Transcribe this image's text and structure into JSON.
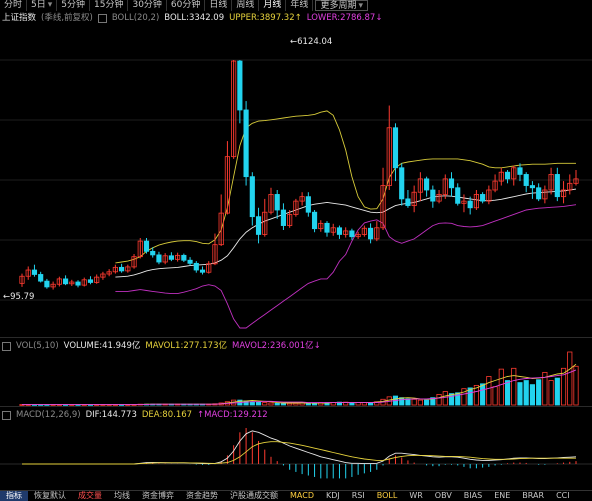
{
  "top_tabs": [
    {
      "label": "分时",
      "active": false,
      "caret": false
    },
    {
      "label": "5日",
      "active": false,
      "caret": true
    },
    {
      "label": "5分钟",
      "active": false,
      "caret": false
    },
    {
      "label": "15分钟",
      "active": false,
      "caret": false
    },
    {
      "label": "30分钟",
      "active": false,
      "caret": false
    },
    {
      "label": "60分钟",
      "active": false,
      "caret": false
    },
    {
      "label": "日线",
      "active": false,
      "caret": false
    },
    {
      "label": "周线",
      "active": false,
      "caret": false
    },
    {
      "label": "月线",
      "active": true,
      "caret": false
    },
    {
      "label": "年线",
      "active": false,
      "caret": false
    },
    {
      "label": "更多周期",
      "active": false,
      "caret": true
    }
  ],
  "main_legend": {
    "index_name": "上证指数",
    "adjust": "(季线,前复权)",
    "indicator": "BOLL(20,2)",
    "boll": "BOLL:3342.09",
    "upper": "UPPER:3897.32",
    "lower": "LOWER:2786.87",
    "up_arrow": "↑",
    "down_arrow": "↓"
  },
  "vol_legend": {
    "indicator": "VOL(5,10)",
    "volume": "VOLUME:41.949亿",
    "mavol1": "MAVOL1:277.173亿",
    "mavol2": "MAVOL2:236.001亿",
    "down_arrow": "↓"
  },
  "macd_legend": {
    "indicator": "MACD(12,26,9)",
    "dif": "DIF:144.773",
    "dea": "DEA:80.167",
    "macd": "MACD:129.212",
    "up_arrow": "↑"
  },
  "annotations": {
    "high": "6124.04",
    "low": "95.79"
  },
  "bottom_tabs": [
    {
      "label": "指标",
      "style": "active"
    },
    {
      "label": "恢复默认",
      "style": ""
    },
    {
      "label": "成交量",
      "style": "hl"
    },
    {
      "label": "均线",
      "style": ""
    },
    {
      "label": "资金博弈",
      "style": ""
    },
    {
      "label": "资金趋势",
      "style": ""
    },
    {
      "label": "沪股通成交额",
      "style": ""
    },
    {
      "label": "MACD",
      "style": "yl"
    },
    {
      "label": "KDJ",
      "style": ""
    },
    {
      "label": "RSI",
      "style": ""
    },
    {
      "label": "BOLL",
      "style": "yl"
    },
    {
      "label": "WR",
      "style": ""
    },
    {
      "label": "OBV",
      "style": ""
    },
    {
      "label": "BIAS",
      "style": ""
    },
    {
      "label": "ENE",
      "style": ""
    },
    {
      "label": "BRAR",
      "style": ""
    },
    {
      "label": "CCI",
      "style": ""
    }
  ],
  "colors": {
    "up": "#ff3b30",
    "down": "#22d3ee",
    "boll_mid": "#e8e8e8",
    "boll_upper": "#d8cc3a",
    "boll_lower": "#c030c0",
    "grid": "#1e1e1e"
  },
  "chart_data": {
    "type": "candlestick",
    "title": "上证指数",
    "period": "季线",
    "indicator": "BOLL(20,2)",
    "y_range": [
      95.79,
      6124.04
    ],
    "max_label": "6124.04",
    "min_label": "95.79",
    "candles": [
      [
        1100,
        1260,
        1020,
        1320
      ],
      [
        1260,
        1400,
        1180,
        1480
      ],
      [
        1400,
        1300,
        1250,
        1520
      ],
      [
        1300,
        1150,
        1120,
        1360
      ],
      [
        1150,
        1020,
        980,
        1200
      ],
      [
        1020,
        1080,
        960,
        1140
      ],
      [
        1080,
        1200,
        1030,
        1250
      ],
      [
        1200,
        1090,
        1060,
        1280
      ],
      [
        1090,
        1130,
        1040,
        1180
      ],
      [
        1130,
        1060,
        1010,
        1170
      ],
      [
        1060,
        1180,
        1030,
        1230
      ],
      [
        1180,
        1120,
        1080,
        1260
      ],
      [
        1120,
        1240,
        1090,
        1300
      ],
      [
        1240,
        1310,
        1180,
        1360
      ],
      [
        1310,
        1360,
        1260,
        1420
      ],
      [
        1360,
        1460,
        1320,
        1520
      ],
      [
        1460,
        1380,
        1340,
        1540
      ],
      [
        1380,
        1470,
        1340,
        1520
      ],
      [
        1470,
        1700,
        1430,
        1760
      ],
      [
        1700,
        2050,
        1660,
        2120
      ],
      [
        2050,
        1820,
        1770,
        2120
      ],
      [
        1820,
        1740,
        1680,
        1910
      ],
      [
        1740,
        1580,
        1530,
        1810
      ],
      [
        1580,
        1720,
        1530,
        1780
      ],
      [
        1720,
        1640,
        1600,
        1800
      ],
      [
        1640,
        1730,
        1590,
        1790
      ],
      [
        1730,
        1620,
        1580,
        1770
      ],
      [
        1620,
        1550,
        1500,
        1690
      ],
      [
        1550,
        1400,
        1340,
        1600
      ],
      [
        1400,
        1350,
        1300,
        1480
      ],
      [
        1350,
        1540,
        1320,
        1600
      ],
      [
        1540,
        1970,
        1510,
        2220
      ],
      [
        1970,
        2680,
        1940,
        3100
      ],
      [
        2680,
        3950,
        2650,
        4300
      ],
      [
        3950,
        6100,
        3900,
        6124.04
      ],
      [
        6100,
        5000,
        4700,
        6124
      ],
      [
        5000,
        3500,
        3300,
        5200
      ],
      [
        3500,
        2600,
        2400,
        3600
      ],
      [
        2600,
        2200,
        2000,
        2800
      ],
      [
        2200,
        2700,
        2150,
        3000
      ],
      [
        2700,
        3100,
        2650,
        3250
      ],
      [
        3100,
        2750,
        2550,
        3200
      ],
      [
        2750,
        2400,
        2300,
        2900
      ],
      [
        2400,
        2650,
        2350,
        2750
      ],
      [
        2650,
        2950,
        2600,
        3000
      ],
      [
        2950,
        3050,
        2850,
        3150
      ],
      [
        3050,
        2700,
        2600,
        3150
      ],
      [
        2700,
        2330,
        2250,
        2750
      ],
      [
        2330,
        2450,
        2260,
        2520
      ],
      [
        2450,
        2250,
        2150,
        2500
      ],
      [
        2250,
        2350,
        2170,
        2440
      ],
      [
        2350,
        2200,
        2100,
        2400
      ],
      [
        2200,
        2280,
        2130,
        2360
      ],
      [
        2280,
        2150,
        2080,
        2330
      ],
      [
        2150,
        2200,
        2100,
        2260
      ],
      [
        2200,
        2340,
        2150,
        2400
      ],
      [
        2340,
        2100,
        2000,
        2450
      ],
      [
        2100,
        2350,
        2050,
        2500
      ],
      [
        2350,
        3300,
        2300,
        3700
      ],
      [
        3300,
        4600,
        3200,
        5100
      ],
      [
        4600,
        3700,
        3400,
        4700
      ],
      [
        3700,
        3000,
        2850,
        3800
      ],
      [
        3000,
        2850,
        2800,
        3200
      ],
      [
        2850,
        3150,
        2700,
        3300
      ],
      [
        3150,
        3450,
        2950,
        3600
      ],
      [
        3450,
        3200,
        3050,
        3500
      ],
      [
        3200,
        2950,
        2800,
        3300
      ],
      [
        2950,
        3100,
        2900,
        3200
      ],
      [
        3100,
        3450,
        3000,
        3550
      ],
      [
        3450,
        3250,
        3050,
        3600
      ],
      [
        3250,
        2900,
        2850,
        3350
      ],
      [
        2900,
        2950,
        2700,
        3100
      ],
      [
        2950,
        2800,
        2650,
        3050
      ],
      [
        2800,
        3100,
        2750,
        3200
      ],
      [
        3100,
        2950,
        2900,
        3150
      ],
      [
        2950,
        3200,
        2880,
        3300
      ],
      [
        3200,
        3400,
        3150,
        3550
      ],
      [
        3400,
        3600,
        3300,
        3700
      ],
      [
        3600,
        3450,
        3350,
        3650
      ],
      [
        3450,
        3700,
        3300,
        3750
      ],
      [
        3700,
        3550,
        3400,
        3800
      ],
      [
        3550,
        3300,
        3150,
        3600
      ],
      [
        3300,
        3250,
        3000,
        3400
      ],
      [
        3250,
        3000,
        2950,
        3350
      ],
      [
        3000,
        3200,
        2900,
        3300
      ],
      [
        3200,
        3550,
        3100,
        3700
      ],
      [
        3550,
        3050,
        2950,
        3700
      ],
      [
        3050,
        3200,
        2900,
        3400
      ],
      [
        3200,
        3350,
        3100,
        3550
      ],
      [
        3350,
        3450,
        3300,
        3650
      ]
    ],
    "boll_upper": [
      null,
      null,
      null,
      null,
      null,
      null,
      null,
      null,
      null,
      null,
      null,
      null,
      null,
      null,
      null,
      1560,
      1580,
      1600,
      1640,
      1700,
      1820,
      1900,
      1960,
      2000,
      2030,
      2050,
      2060,
      2060,
      2040,
      2000,
      1990,
      2080,
      2300,
      2800,
      3500,
      4200,
      4600,
      4700,
      4750,
      4760,
      4780,
      4800,
      4820,
      4840,
      4860,
      4870,
      4880,
      4900,
      4950,
      4980,
      4880,
      4550,
      4100,
      3500,
      3050,
      2820,
      2770,
      2780,
      3000,
      3480,
      3700,
      3800,
      3830,
      3850,
      3870,
      3890,
      3900,
      3900,
      3900,
      3900,
      3900,
      3880,
      3860,
      3820,
      3780,
      3720,
      3700,
      3700,
      3720,
      3740,
      3760,
      3770,
      3780,
      3780,
      3780,
      3790,
      3800,
      3800,
      3800,
      3800
    ],
    "boll_mid": [
      null,
      null,
      null,
      null,
      null,
      null,
      null,
      null,
      null,
      null,
      null,
      null,
      null,
      null,
      null,
      1240,
      1250,
      1260,
      1290,
      1330,
      1380,
      1410,
      1430,
      1440,
      1450,
      1460,
      1480,
      1500,
      1510,
      1520,
      1530,
      1560,
      1620,
      1720,
      1900,
      2100,
      2250,
      2350,
      2430,
      2500,
      2550,
      2600,
      2650,
      2700,
      2750,
      2800,
      2850,
      2880,
      2900,
      2920,
      2900,
      2880,
      2860,
      2820,
      2780,
      2740,
      2700,
      2690,
      2700,
      2780,
      2850,
      2880,
      2900,
      2920,
      2960,
      3000,
      3040,
      3060,
      3070,
      3060,
      3040,
      3020,
      3000,
      2980,
      2960,
      2960,
      2970,
      2990,
      3020,
      3050,
      3080,
      3110,
      3130,
      3140,
      3150,
      3160,
      3170,
      3180,
      3200,
      3220
    ],
    "boll_lower": [
      null,
      null,
      null,
      null,
      null,
      null,
      null,
      null,
      null,
      null,
      null,
      null,
      null,
      null,
      null,
      920,
      920,
      920,
      940,
      960,
      940,
      920,
      900,
      880,
      870,
      870,
      900,
      940,
      980,
      1040,
      1070,
      1040,
      940,
      640,
      300,
      95.79,
      95.79,
      200,
      300,
      400,
      500,
      600,
      700,
      800,
      900,
      1000,
      1100,
      1150,
      1200,
      1200,
      1350,
      1600,
      1750,
      2050,
      2300,
      2460,
      2500,
      2530,
      2450,
      2150,
      2050,
      2000,
      2050,
      2100,
      2200,
      2300,
      2400,
      2450,
      2460,
      2450,
      2400,
      2380,
      2370,
      2380,
      2400,
      2450,
      2500,
      2550,
      2600,
      2650,
      2700,
      2750,
      2770,
      2790,
      2800,
      2810,
      2820,
      2830,
      2850,
      2870
    ],
    "volume": [
      1,
      1,
      1,
      1,
      1,
      1,
      1,
      1,
      1,
      1,
      1,
      1,
      1,
      1,
      1,
      1,
      1,
      1,
      1,
      2,
      2,
      2,
      2,
      2,
      2,
      2,
      2,
      2,
      2,
      2,
      2,
      3,
      5,
      8,
      12,
      12,
      10,
      8,
      7,
      6,
      5,
      4,
      4,
      4,
      4,
      5,
      5,
      5,
      6,
      6,
      6,
      7,
      7,
      6,
      6,
      6,
      6,
      8,
      14,
      20,
      22,
      18,
      15,
      14,
      12,
      12,
      18,
      26,
      33,
      28,
      30,
      40,
      42,
      48,
      52,
      70,
      45,
      88,
      60,
      90,
      55,
      60,
      50,
      62,
      80,
      60,
      66,
      90,
      130,
      95
    ],
    "mavol1": [
      1,
      1,
      1,
      1,
      1,
      1,
      1,
      1,
      1,
      1,
      1,
      1,
      1,
      1,
      1,
      1,
      1,
      1,
      1,
      1,
      2,
      2,
      2,
      2,
      2,
      2,
      2,
      2,
      2,
      2,
      2,
      2,
      3,
      5,
      7,
      9,
      10,
      11,
      10,
      9,
      8,
      6,
      5,
      5,
      5,
      5,
      5,
      5,
      5,
      5,
      6,
      6,
      6,
      6,
      6,
      6,
      6,
      7,
      9,
      12,
      15,
      17,
      18,
      17,
      15,
      14,
      15,
      18,
      22,
      25,
      28,
      32,
      38,
      42,
      48,
      55,
      60,
      65,
      70,
      72,
      70,
      68,
      65,
      66,
      68,
      72,
      76,
      78,
      88,
      100
    ],
    "mavol2": [
      1,
      1,
      1,
      1,
      1,
      1,
      1,
      1,
      1,
      1,
      1,
      1,
      1,
      1,
      1,
      1,
      1,
      1,
      1,
      1,
      1,
      2,
      2,
      2,
      2,
      2,
      2,
      2,
      2,
      2,
      2,
      2,
      3,
      4,
      5,
      6,
      7,
      8,
      8,
      9,
      9,
      8,
      7,
      7,
      7,
      7,
      6,
      6,
      6,
      6,
      6,
      6,
      6,
      6,
      6,
      6,
      6,
      6,
      7,
      9,
      11,
      13,
      14,
      15,
      15,
      15,
      16,
      17,
      19,
      21,
      24,
      27,
      30,
      33,
      37,
      41,
      45,
      50,
      55,
      60,
      63,
      65,
      66,
      67,
      68,
      70,
      72,
      74,
      80,
      86
    ],
    "dif": [
      0,
      0,
      0,
      0,
      0,
      0,
      0,
      0,
      0,
      0,
      0,
      0,
      0,
      0,
      0,
      0,
      0,
      0,
      0,
      10,
      20,
      22,
      20,
      18,
      17,
      17,
      16,
      14,
      10,
      6,
      4,
      8,
      30,
      80,
      180,
      320,
      420,
      460,
      440,
      400,
      360,
      330,
      290,
      250,
      220,
      190,
      160,
      130,
      100,
      80,
      60,
      40,
      20,
      10,
      10,
      5,
      5,
      10,
      40,
      110,
      150,
      150,
      140,
      130,
      120,
      110,
      100,
      95,
      100,
      100,
      95,
      80,
      65,
      55,
      50,
      50,
      55,
      60,
      70,
      80,
      85,
      85,
      80,
      75,
      75,
      80,
      85,
      90,
      95,
      100
    ],
    "dea": [
      0,
      0,
      0,
      0,
      0,
      0,
      0,
      0,
      0,
      0,
      0,
      0,
      0,
      0,
      0,
      0,
      0,
      0,
      0,
      5,
      10,
      14,
      16,
      16,
      16,
      16,
      16,
      15,
      14,
      12,
      10,
      9,
      12,
      20,
      50,
      100,
      170,
      240,
      280,
      300,
      310,
      310,
      300,
      290,
      275,
      260,
      240,
      220,
      200,
      180,
      160,
      140,
      120,
      100,
      85,
      70,
      60,
      50,
      50,
      70,
      90,
      105,
      115,
      120,
      120,
      120,
      115,
      110,
      105,
      105,
      105,
      100,
      95,
      85,
      75,
      70,
      65,
      65,
      65,
      70,
      75,
      78,
      80,
      80,
      80,
      80,
      80,
      80,
      80,
      80
    ],
    "macd": [
      0,
      0,
      0,
      0,
      0,
      0,
      0,
      0,
      0,
      0,
      0,
      0,
      0,
      0,
      0,
      0,
      0,
      0,
      0,
      10,
      20,
      16,
      8,
      4,
      2,
      2,
      0,
      -2,
      -8,
      -12,
      -12,
      -2,
      36,
      120,
      260,
      440,
      500,
      440,
      320,
      200,
      100,
      40,
      -20,
      -80,
      -110,
      -140,
      -160,
      -180,
      -200,
      -200,
      -200,
      -200,
      -200,
      -180,
      -150,
      -130,
      -110,
      -80,
      -20,
      80,
      120,
      90,
      50,
      20,
      0,
      -20,
      -30,
      -30,
      -10,
      -10,
      -20,
      -40,
      -60,
      -60,
      -50,
      -40,
      -20,
      -10,
      10,
      20,
      20,
      15,
      0,
      -10,
      -10,
      0,
      10,
      20,
      30,
      40
    ]
  }
}
